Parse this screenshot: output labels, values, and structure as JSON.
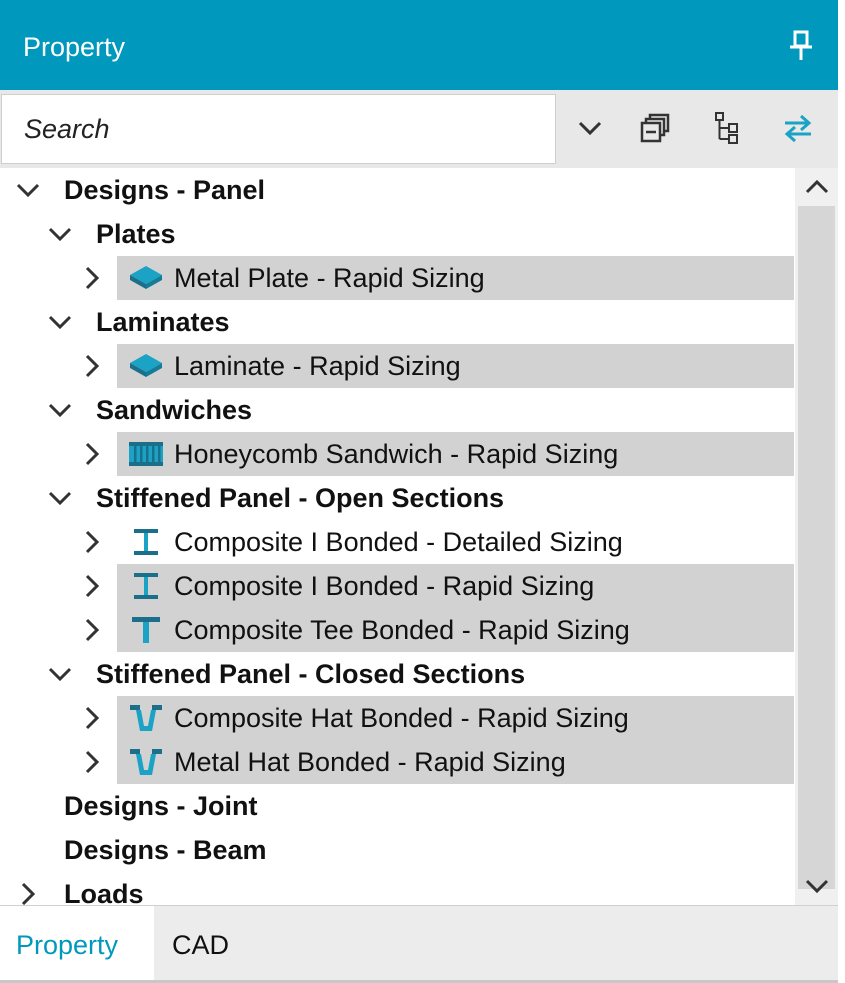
{
  "window": {
    "title": "Property"
  },
  "search": {
    "placeholder": "Search",
    "value": ""
  },
  "colors": {
    "accent": "#0099bd",
    "highlight": "#d2d2d2",
    "icon_teal": "#1aa3c4",
    "icon_dark": "#1b6f8a"
  },
  "tree": {
    "root": "Designs - Panel",
    "plates": {
      "label": "Plates",
      "items": [
        "Metal Plate - Rapid Sizing"
      ]
    },
    "laminates": {
      "label": "Laminates",
      "items": [
        "Laminate - Rapid Sizing"
      ]
    },
    "sandwiches": {
      "label": "Sandwiches",
      "items": [
        "Honeycomb Sandwich - Rapid Sizing"
      ]
    },
    "open": {
      "label": "Stiffened Panel - Open Sections",
      "items": [
        "Composite I Bonded - Detailed Sizing",
        "Composite I Bonded - Rapid Sizing",
        "Composite Tee Bonded - Rapid Sizing"
      ]
    },
    "closed": {
      "label": "Stiffened Panel - Closed Sections",
      "items": [
        "Composite Hat Bonded - Rapid Sizing",
        "Metal Hat Bonded - Rapid Sizing"
      ]
    },
    "joint": "Designs - Joint",
    "beam": "Designs - Beam",
    "loads": "Loads"
  },
  "tabs": [
    {
      "label": "Property",
      "active": true
    },
    {
      "label": "CAD",
      "active": false
    }
  ]
}
